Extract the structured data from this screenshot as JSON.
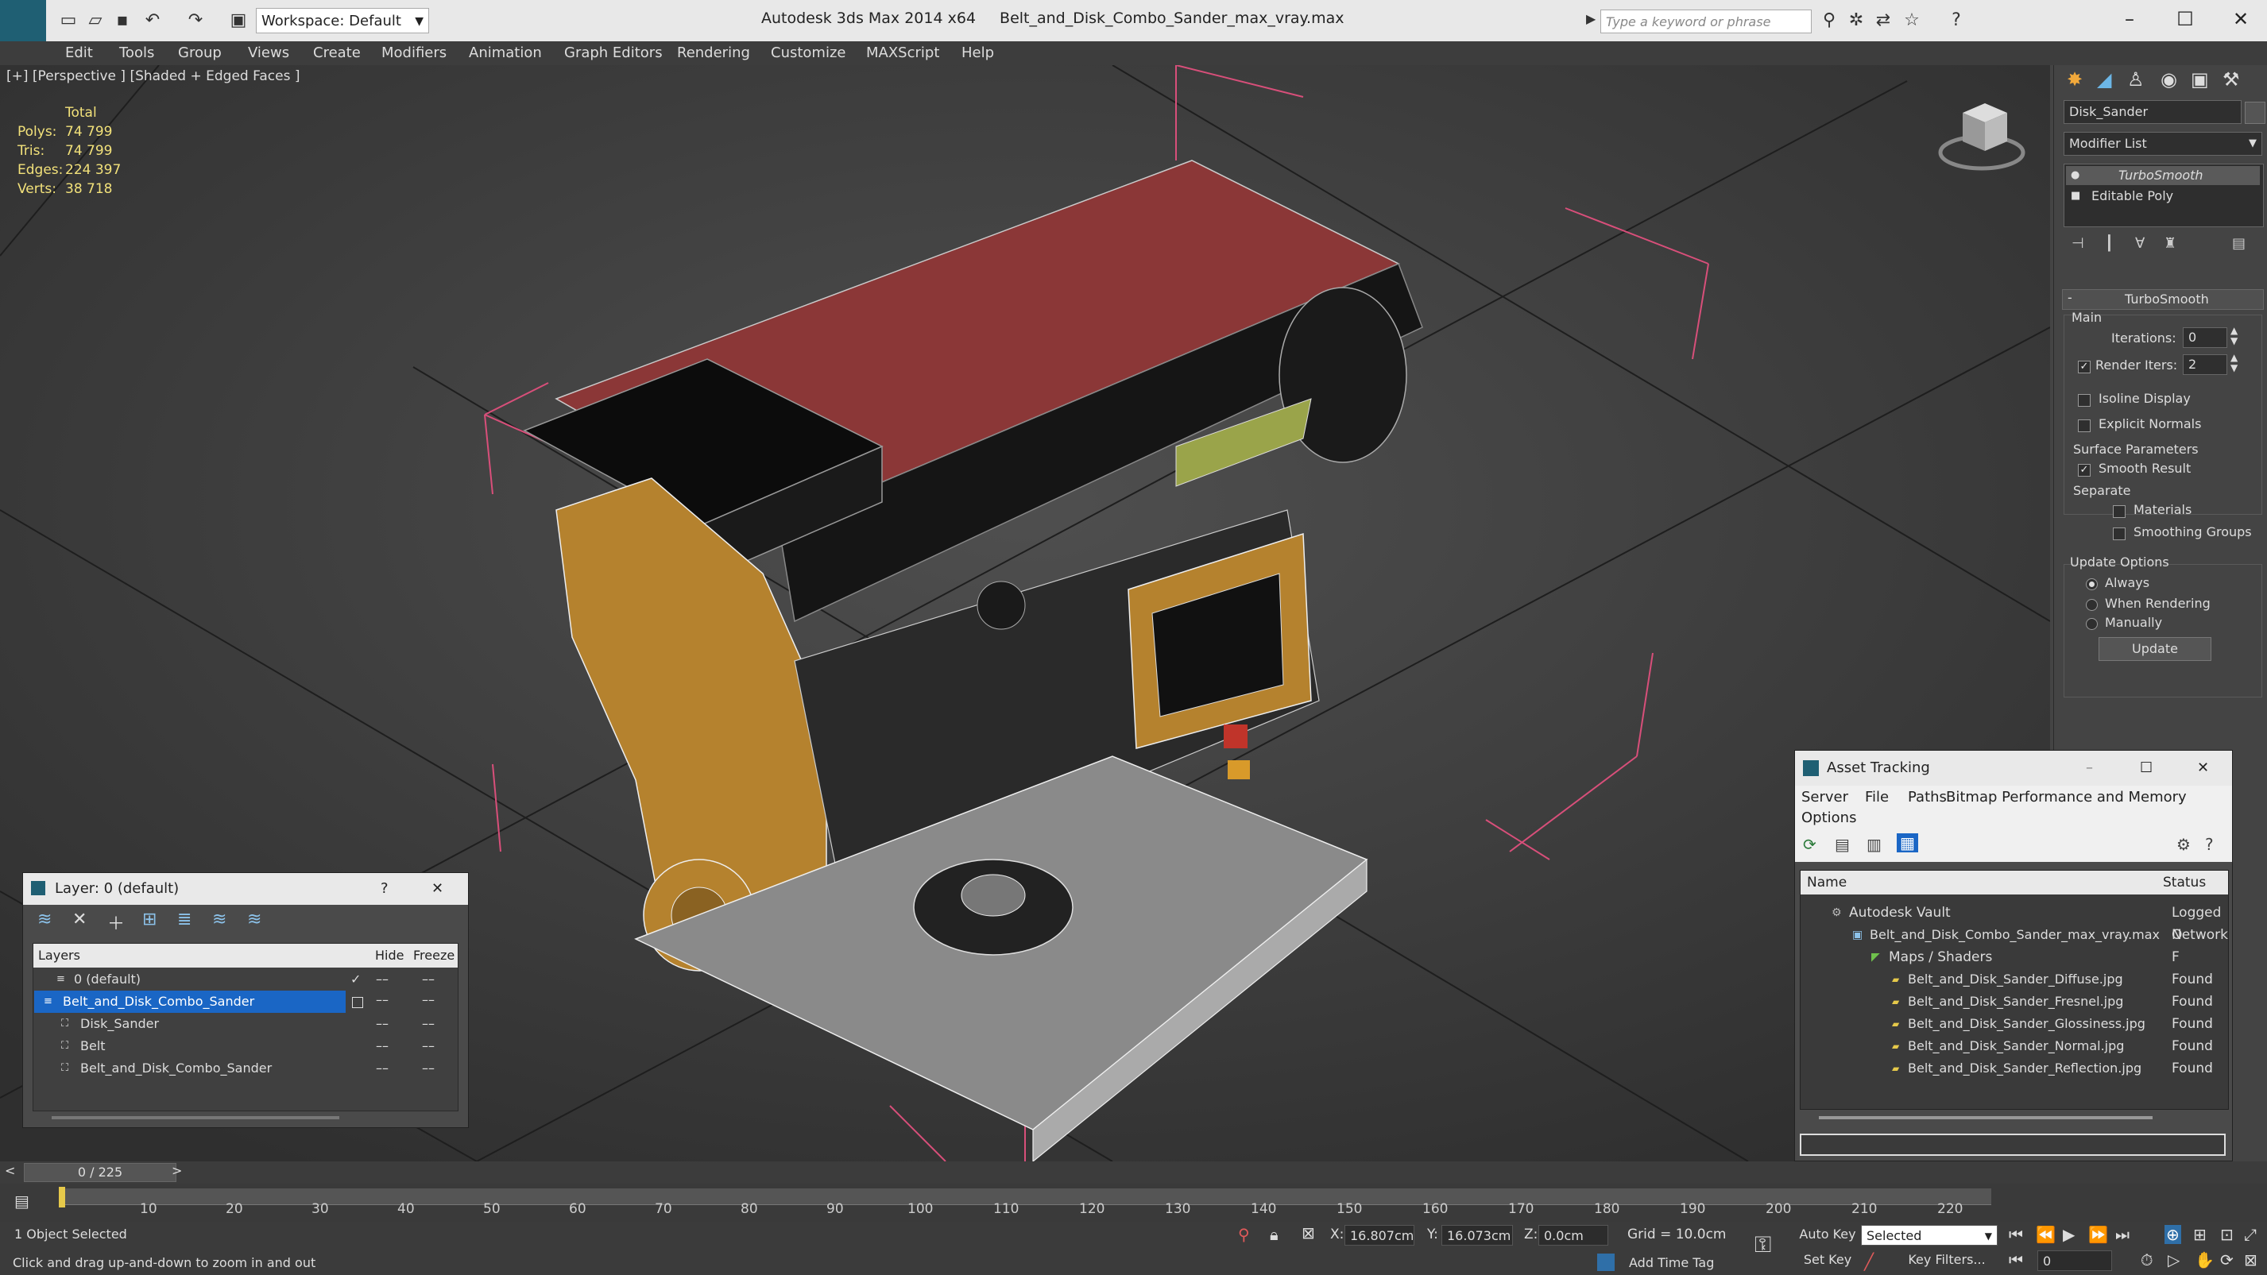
{
  "titlebar": {
    "app": "Autodesk 3ds Max  2014 x64",
    "file": "Belt_and_Disk_Combo_Sander_max_vray.max",
    "workspace": "Workspace: Default",
    "search_placeholder": "Type a keyword or phrase"
  },
  "menu": [
    "Edit",
    "Tools",
    "Group",
    "Views",
    "Create",
    "Modifiers",
    "Animation",
    "Graph Editors",
    "Rendering",
    "Customize",
    "MAXScript",
    "Help"
  ],
  "viewport": {
    "label": "[+] [Perspective ] [Shaded + Edged Faces ]",
    "stats": {
      "header": "Total",
      "rows": [
        {
          "label": "Polys:",
          "value": "74 799"
        },
        {
          "label": "Tris:",
          "value": "74 799"
        },
        {
          "label": "Edges:",
          "value": "224 397"
        },
        {
          "label": "Verts:",
          "value": "38 718"
        }
      ]
    }
  },
  "command_panel": {
    "object_name": "Disk_Sander",
    "modifier_list": "Modifier List",
    "stack": [
      "TurboSmooth",
      "Editable Poly"
    ],
    "rollout_title": "TurboSmooth",
    "main": "Main",
    "iterations_label": "Iterations:",
    "iterations_value": "0",
    "render_iters_label": "Render Iters:",
    "render_iters_value": "2",
    "isoline": "Isoline Display",
    "explicit": "Explicit Normals",
    "surface_params": "Surface Parameters",
    "smooth_result": "Smooth Result",
    "separate": "Separate",
    "materials": "Materials",
    "smoothing_groups": "Smoothing Groups",
    "update_options": "Update Options",
    "always": "Always",
    "when_rendering": "When Rendering",
    "manually": "Manually",
    "update_btn": "Update"
  },
  "layer_window": {
    "title": "Layer: 0 (default)",
    "help": "?",
    "col_layers": "Layers",
    "col_hide": "Hide",
    "col_freeze": "Freeze",
    "rows": [
      {
        "name": "0 (default)"
      },
      {
        "name": "Belt_and_Disk_Combo_Sander"
      },
      {
        "name": "Disk_Sander"
      },
      {
        "name": "Belt"
      },
      {
        "name": "Belt_and_Disk_Combo_Sander"
      }
    ]
  },
  "asset_window": {
    "title": "Asset Tracking",
    "menu1": [
      "Server",
      "File",
      "Paths",
      "Bitmap Performance and Memory"
    ],
    "menu2": "Options",
    "col_name": "Name",
    "col_status": "Status",
    "rows": [
      {
        "name": "Autodesk Vault",
        "status": "Logged O"
      },
      {
        "name": "Belt_and_Disk_Combo_Sander_max_vray.max",
        "status": "Network F"
      },
      {
        "name": "Maps / Shaders",
        "status": ""
      },
      {
        "name": "Belt_and_Disk_Sander_Diffuse.jpg",
        "status": "Found"
      },
      {
        "name": "Belt_and_Disk_Sander_Fresnel.jpg",
        "status": "Found"
      },
      {
        "name": "Belt_and_Disk_Sander_Glossiness.jpg",
        "status": "Found"
      },
      {
        "name": "Belt_and_Disk_Sander_Normal.jpg",
        "status": "Found"
      },
      {
        "name": "Belt_and_Disk_Sander_Reflection.jpg",
        "status": "Found"
      }
    ]
  },
  "timeline": {
    "frame": "0 / 225",
    "ticks": [
      "10",
      "20",
      "30",
      "40",
      "50",
      "60",
      "70",
      "80",
      "90",
      "100",
      "110",
      "120",
      "130",
      "140",
      "150",
      "160",
      "170",
      "180",
      "190",
      "200",
      "210",
      "220"
    ]
  },
  "status": {
    "selected": "1 Object Selected",
    "prompt": "Click and drag up-and-down to zoom in and out",
    "x_label": "X:",
    "x_value": "16.807cm",
    "y_label": "Y:",
    "y_value": "16.073cm",
    "z_label": "Z:",
    "z_value": "0.0cm",
    "grid": "Grid = 10.0cm",
    "auto_key": "Auto Key",
    "auto_key_value": "Selected",
    "set_key": "Set Key",
    "key_filters": "Key Filters...",
    "add_time_tag": "Add Time Tag",
    "frame_value": "0"
  }
}
